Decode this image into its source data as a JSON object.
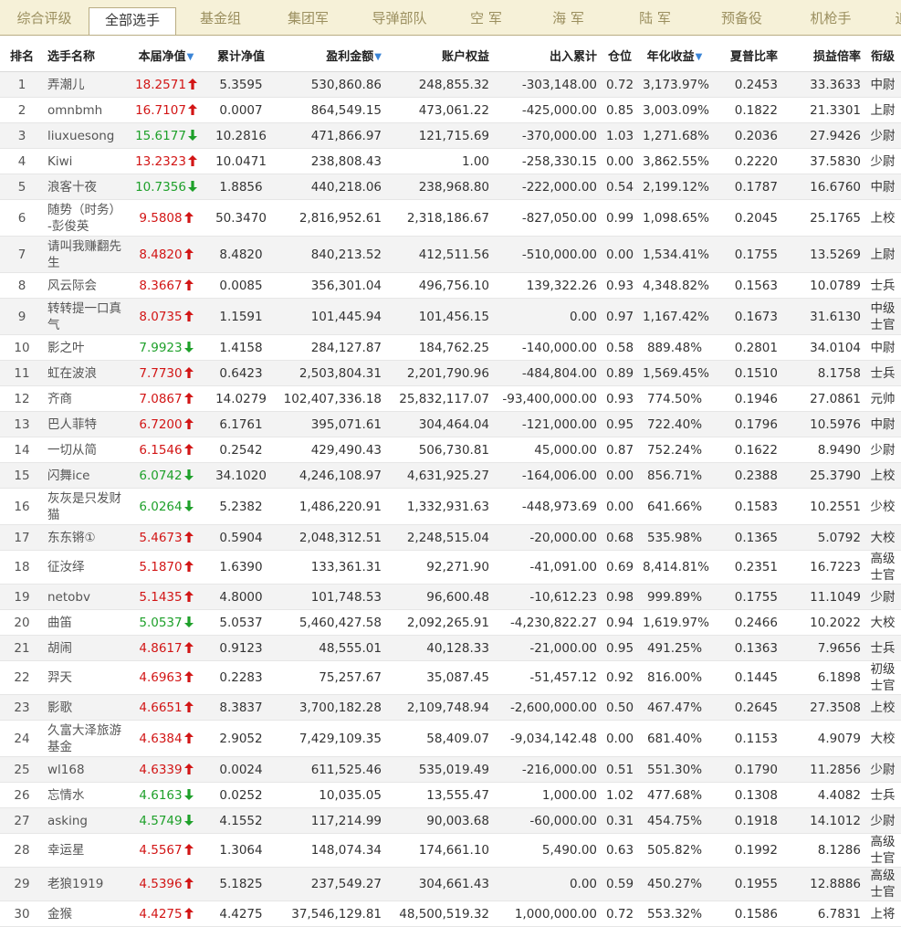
{
  "tabs": [
    {
      "label": "综合评级",
      "active": false
    },
    {
      "label": "全部选手",
      "active": true
    },
    {
      "label": "基金组",
      "active": false
    },
    {
      "label": "集团军",
      "active": false
    },
    {
      "label": "导弹部队",
      "active": false
    },
    {
      "label": "空 军",
      "active": false
    },
    {
      "label": "海 军",
      "active": false
    },
    {
      "label": "陆 军",
      "active": false
    },
    {
      "label": "预备役",
      "active": false
    },
    {
      "label": "机枪手",
      "active": false
    },
    {
      "label": "追",
      "active": false
    }
  ],
  "columns": [
    {
      "key": "rank",
      "label": "排名",
      "sortable": false
    },
    {
      "key": "name",
      "label": "选手名称",
      "sortable": false
    },
    {
      "key": "nav",
      "label": "本届净值",
      "sortable": true
    },
    {
      "key": "cum_nav",
      "label": "累计净值",
      "sortable": false
    },
    {
      "key": "profit",
      "label": "盈利金额",
      "sortable": true
    },
    {
      "key": "equity",
      "label": "账户权益",
      "sortable": false
    },
    {
      "key": "flow",
      "label": "出入累计",
      "sortable": false
    },
    {
      "key": "position",
      "label": "仓位",
      "sortable": false
    },
    {
      "key": "annual",
      "label": "年化收益",
      "sortable": true
    },
    {
      "key": "sharpe",
      "label": "夏普比率",
      "sortable": false
    },
    {
      "key": "pl_ratio",
      "label": "损益倍率",
      "sortable": false
    },
    {
      "key": "rank_title",
      "label": "衔级",
      "sortable": false
    }
  ],
  "colors": {
    "up": "#d21515",
    "down": "#1ea02a",
    "sort_icon": "#3a84d6",
    "tab_bar": "#f6f1d8"
  },
  "icons": {
    "up": "arrow-up-icon",
    "down": "arrow-down-icon",
    "sort": "sort-down-icon"
  },
  "rows": [
    {
      "rank": "1",
      "name": "弄潮儿",
      "nav": "18.2571",
      "trend": "up",
      "cum_nav": "5.3595",
      "profit": "530,860.86",
      "equity": "248,855.32",
      "flow": "-303,148.00",
      "position": "0.72",
      "annual": "3,173.97%",
      "sharpe": "0.2453",
      "pl_ratio": "33.3633",
      "rank_title": "中尉"
    },
    {
      "rank": "2",
      "name": "omnbmh",
      "nav": "16.7107",
      "trend": "up",
      "cum_nav": "0.0007",
      "profit": "864,549.15",
      "equity": "473,061.22",
      "flow": "-425,000.00",
      "position": "0.85",
      "annual": "3,003.09%",
      "sharpe": "0.1822",
      "pl_ratio": "21.3301",
      "rank_title": "上尉"
    },
    {
      "rank": "3",
      "name": "liuxuesong",
      "nav": "15.6177",
      "trend": "down",
      "cum_nav": "10.2816",
      "profit": "471,866.97",
      "equity": "121,715.69",
      "flow": "-370,000.00",
      "position": "1.03",
      "annual": "1,271.68%",
      "sharpe": "0.2036",
      "pl_ratio": "27.9426",
      "rank_title": "少尉"
    },
    {
      "rank": "4",
      "name": "Kiwi",
      "nav": "13.2323",
      "trend": "up",
      "cum_nav": "10.0471",
      "profit": "238,808.43",
      "equity": "1.00",
      "flow": "-258,330.15",
      "position": "0.00",
      "annual": "3,862.55%",
      "sharpe": "0.2220",
      "pl_ratio": "37.5830",
      "rank_title": "少尉"
    },
    {
      "rank": "5",
      "name": "浪客十夜",
      "nav": "10.7356",
      "trend": "down",
      "cum_nav": "1.8856",
      "profit": "440,218.06",
      "equity": "238,968.80",
      "flow": "-222,000.00",
      "position": "0.54",
      "annual": "2,199.12%",
      "sharpe": "0.1787",
      "pl_ratio": "16.6760",
      "rank_title": "中尉"
    },
    {
      "rank": "6",
      "name": "随势（时务）-彭俊英",
      "nav": "9.5808",
      "trend": "up",
      "cum_nav": "50.3470",
      "profit": "2,816,952.61",
      "equity": "2,318,186.67",
      "flow": "-827,050.00",
      "position": "0.99",
      "annual": "1,098.65%",
      "sharpe": "0.2045",
      "pl_ratio": "25.1765",
      "rank_title": "上校"
    },
    {
      "rank": "7",
      "name": "请叫我赚翻先生",
      "nav": "8.4820",
      "trend": "up",
      "cum_nav": "8.4820",
      "profit": "840,213.52",
      "equity": "412,511.56",
      "flow": "-510,000.00",
      "position": "0.00",
      "annual": "1,534.41%",
      "sharpe": "0.1755",
      "pl_ratio": "13.5269",
      "rank_title": "上尉"
    },
    {
      "rank": "8",
      "name": "风云际会",
      "nav": "8.3667",
      "trend": "up",
      "cum_nav": "0.0085",
      "profit": "356,301.04",
      "equity": "496,756.10",
      "flow": "139,322.26",
      "position": "0.93",
      "annual": "4,348.82%",
      "sharpe": "0.1563",
      "pl_ratio": "10.0789",
      "rank_title": "士兵"
    },
    {
      "rank": "9",
      "name": "转转提一口真气",
      "nav": "8.0735",
      "trend": "up",
      "cum_nav": "1.1591",
      "profit": "101,445.94",
      "equity": "101,456.15",
      "flow": "0.00",
      "position": "0.97",
      "annual": "1,167.42%",
      "sharpe": "0.1673",
      "pl_ratio": "31.6130",
      "rank_title": "中级士官"
    },
    {
      "rank": "10",
      "name": "影之叶",
      "nav": "7.9923",
      "trend": "down",
      "cum_nav": "1.4158",
      "profit": "284,127.87",
      "equity": "184,762.25",
      "flow": "-140,000.00",
      "position": "0.58",
      "annual": "889.48%",
      "sharpe": "0.2801",
      "pl_ratio": "34.0104",
      "rank_title": "中尉"
    },
    {
      "rank": "11",
      "name": "虹在波浪",
      "nav": "7.7730",
      "trend": "up",
      "cum_nav": "0.6423",
      "profit": "2,503,804.31",
      "equity": "2,201,790.96",
      "flow": "-484,804.00",
      "position": "0.89",
      "annual": "1,569.45%",
      "sharpe": "0.1510",
      "pl_ratio": "8.1758",
      "rank_title": "士兵"
    },
    {
      "rank": "12",
      "name": "齐商",
      "nav": "7.0867",
      "trend": "up",
      "cum_nav": "14.0279",
      "profit": "102,407,336.18",
      "equity": "25,832,117.07",
      "flow": "-93,400,000.00",
      "position": "0.93",
      "annual": "774.50%",
      "sharpe": "0.1946",
      "pl_ratio": "27.0861",
      "rank_title": "元帅"
    },
    {
      "rank": "13",
      "name": "巴人菲特",
      "nav": "6.7200",
      "trend": "up",
      "cum_nav": "6.1761",
      "profit": "395,071.61",
      "equity": "304,464.04",
      "flow": "-121,000.00",
      "position": "0.95",
      "annual": "722.40%",
      "sharpe": "0.1796",
      "pl_ratio": "10.5976",
      "rank_title": "中尉"
    },
    {
      "rank": "14",
      "name": "一切从简",
      "nav": "6.1546",
      "trend": "up",
      "cum_nav": "0.2542",
      "profit": "429,490.43",
      "equity": "506,730.81",
      "flow": "45,000.00",
      "position": "0.87",
      "annual": "752.24%",
      "sharpe": "0.1622",
      "pl_ratio": "8.9490",
      "rank_title": "少尉"
    },
    {
      "rank": "15",
      "name": "闪舞ice",
      "nav": "6.0742",
      "trend": "down",
      "cum_nav": "34.1020",
      "profit": "4,246,108.97",
      "equity": "4,631,925.27",
      "flow": "-164,006.00",
      "position": "0.00",
      "annual": "856.71%",
      "sharpe": "0.2388",
      "pl_ratio": "25.3790",
      "rank_title": "上校"
    },
    {
      "rank": "16",
      "name": "灰灰是只发财猫",
      "nav": "6.0264",
      "trend": "down",
      "cum_nav": "5.2382",
      "profit": "1,486,220.91",
      "equity": "1,332,931.63",
      "flow": "-448,973.69",
      "position": "0.00",
      "annual": "641.66%",
      "sharpe": "0.1583",
      "pl_ratio": "10.2551",
      "rank_title": "少校"
    },
    {
      "rank": "17",
      "name": "东东锵①",
      "nav": "5.4673",
      "trend": "up",
      "cum_nav": "0.5904",
      "profit": "2,048,312.51",
      "equity": "2,248,515.04",
      "flow": "-20,000.00",
      "position": "0.68",
      "annual": "535.98%",
      "sharpe": "0.1365",
      "pl_ratio": "5.0792",
      "rank_title": "大校"
    },
    {
      "rank": "18",
      "name": "征汝绎",
      "nav": "5.1870",
      "trend": "up",
      "cum_nav": "1.6390",
      "profit": "133,361.31",
      "equity": "92,271.90",
      "flow": "-41,091.00",
      "position": "0.69",
      "annual": "8,414.81%",
      "sharpe": "0.2351",
      "pl_ratio": "16.7223",
      "rank_title": "高级士官"
    },
    {
      "rank": "19",
      "name": "netobv",
      "nav": "5.1435",
      "trend": "up",
      "cum_nav": "4.8000",
      "profit": "101,748.53",
      "equity": "96,600.48",
      "flow": "-10,612.23",
      "position": "0.98",
      "annual": "999.89%",
      "sharpe": "0.1755",
      "pl_ratio": "11.1049",
      "rank_title": "少尉"
    },
    {
      "rank": "20",
      "name": "曲笛",
      "nav": "5.0537",
      "trend": "down",
      "cum_nav": "5.0537",
      "profit": "5,460,427.58",
      "equity": "2,092,265.91",
      "flow": "-4,230,822.27",
      "position": "0.94",
      "annual": "1,619.97%",
      "sharpe": "0.2466",
      "pl_ratio": "10.2022",
      "rank_title": "大校"
    },
    {
      "rank": "21",
      "name": "胡闹",
      "nav": "4.8617",
      "trend": "up",
      "cum_nav": "0.9123",
      "profit": "48,555.01",
      "equity": "40,128.33",
      "flow": "-21,000.00",
      "position": "0.95",
      "annual": "491.25%",
      "sharpe": "0.1363",
      "pl_ratio": "7.9656",
      "rank_title": "士兵"
    },
    {
      "rank": "22",
      "name": "羿天",
      "nav": "4.6963",
      "trend": "up",
      "cum_nav": "0.2283",
      "profit": "75,257.67",
      "equity": "35,087.45",
      "flow": "-51,457.12",
      "position": "0.92",
      "annual": "816.00%",
      "sharpe": "0.1445",
      "pl_ratio": "6.1898",
      "rank_title": "初级士官"
    },
    {
      "rank": "23",
      "name": "影歌",
      "nav": "4.6651",
      "trend": "up",
      "cum_nav": "8.3837",
      "profit": "3,700,182.28",
      "equity": "2,109,748.94",
      "flow": "-2,600,000.00",
      "position": "0.50",
      "annual": "467.47%",
      "sharpe": "0.2645",
      "pl_ratio": "27.3508",
      "rank_title": "上校"
    },
    {
      "rank": "24",
      "name": "久富大泽旅游基金",
      "nav": "4.6384",
      "trend": "up",
      "cum_nav": "2.9052",
      "profit": "7,429,109.35",
      "equity": "58,409.07",
      "flow": "-9,034,142.48",
      "position": "0.00",
      "annual": "681.40%",
      "sharpe": "0.1153",
      "pl_ratio": "4.9079",
      "rank_title": "大校"
    },
    {
      "rank": "25",
      "name": "wl168",
      "nav": "4.6339",
      "trend": "up",
      "cum_nav": "0.0024",
      "profit": "611,525.46",
      "equity": "535,019.49",
      "flow": "-216,000.00",
      "position": "0.51",
      "annual": "551.30%",
      "sharpe": "0.1790",
      "pl_ratio": "11.2856",
      "rank_title": "少尉"
    },
    {
      "rank": "26",
      "name": "忘情水",
      "nav": "4.6163",
      "trend": "down",
      "cum_nav": "0.0252",
      "profit": "10,035.05",
      "equity": "13,555.47",
      "flow": "1,000.00",
      "position": "1.02",
      "annual": "477.68%",
      "sharpe": "0.1308",
      "pl_ratio": "4.4082",
      "rank_title": "士兵"
    },
    {
      "rank": "27",
      "name": "asking",
      "nav": "4.5749",
      "trend": "down",
      "cum_nav": "4.1552",
      "profit": "117,214.99",
      "equity": "90,003.68",
      "flow": "-60,000.00",
      "position": "0.31",
      "annual": "454.75%",
      "sharpe": "0.1918",
      "pl_ratio": "14.1012",
      "rank_title": "少尉"
    },
    {
      "rank": "28",
      "name": "幸运星",
      "nav": "4.5567",
      "trend": "up",
      "cum_nav": "1.3064",
      "profit": "148,074.34",
      "equity": "174,661.10",
      "flow": "5,490.00",
      "position": "0.63",
      "annual": "505.82%",
      "sharpe": "0.1992",
      "pl_ratio": "8.1286",
      "rank_title": "高级士官"
    },
    {
      "rank": "29",
      "name": "老狼1919",
      "nav": "4.5396",
      "trend": "up",
      "cum_nav": "5.1825",
      "profit": "237,549.27",
      "equity": "304,661.43",
      "flow": "0.00",
      "position": "0.59",
      "annual": "450.27%",
      "sharpe": "0.1955",
      "pl_ratio": "12.8886",
      "rank_title": "高级士官"
    },
    {
      "rank": "30",
      "name": "金猴",
      "nav": "4.4275",
      "trend": "up",
      "cum_nav": "4.4275",
      "profit": "37,546,129.81",
      "equity": "48,500,519.32",
      "flow": "1,000,000.00",
      "position": "0.72",
      "annual": "553.32%",
      "sharpe": "0.1586",
      "pl_ratio": "6.7831",
      "rank_title": "上将"
    }
  ]
}
